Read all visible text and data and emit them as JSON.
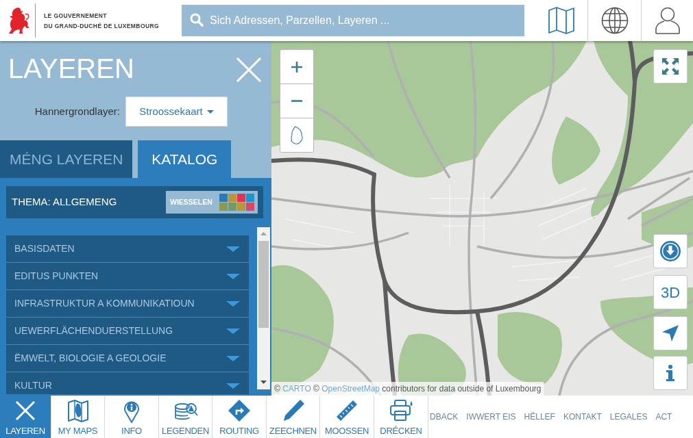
{
  "header": {
    "logo_lines": [
      "LE GOUVERNEMENT",
      "DU GRAND-DUCHÉ DE LUXEMBOURG"
    ],
    "search": {
      "placeholder": "Sich Adressen, Parzellen, Layeren ..."
    }
  },
  "panel": {
    "title": "LAYEREN",
    "background_label": "Hannergrondlayer:",
    "background_value": "Stroossekaart",
    "tabs": [
      {
        "label": "MÉNG LAYEREN",
        "selected": false
      },
      {
        "label": "KATALOG",
        "selected": true
      }
    ],
    "theme": {
      "label": "THEMA: ALLGEMENG",
      "button": "WIESSELEN",
      "swatches": [
        {
          "color": "#2a7ab8"
        },
        {
          "color": "#b8963a"
        },
        {
          "color": "#e0335a"
        },
        {
          "color": "#1e95c8"
        },
        {
          "color": "#8a9a4e"
        },
        {
          "color": "#739a6a"
        },
        {
          "color": "#b8963a"
        },
        {
          "color": "#d6476a"
        }
      ]
    },
    "catalog": [
      {
        "label": "BASISDATEN"
      },
      {
        "label": "EDITUS PUNKTEN"
      },
      {
        "label": "INFRASTRUKTUR A KOMMUNIKATIOUN"
      },
      {
        "label": "UEWERFLÄCHENDUERSTELLUNG"
      },
      {
        "label": "ËMWELT, BIOLOGIE A GEOLOGIE"
      },
      {
        "label": "KULTUR"
      }
    ]
  },
  "map": {
    "button_3d": "3D",
    "attribution": [
      {
        "kind": "text",
        "text": "©"
      },
      {
        "kind": "link",
        "text": "CARTO"
      },
      {
        "kind": "text",
        "text": "©"
      },
      {
        "kind": "link",
        "text": "OpenStreetMap"
      },
      {
        "kind": "text",
        "text": "contributors for data outside of Luxembourg"
      }
    ]
  },
  "bottom_bar": {
    "items": [
      {
        "kind": "close",
        "label": "LAYEREN",
        "selected": true
      },
      {
        "kind": "map",
        "label": "MY MAPS",
        "selected": false
      },
      {
        "kind": "info",
        "label": "INFO",
        "selected": false
      },
      {
        "kind": "legend",
        "label": "LEGENDEN",
        "selected": false
      },
      {
        "kind": "routing",
        "label": "ROUTING",
        "selected": false
      },
      {
        "kind": "pencil",
        "label": "ZEECHNEN",
        "selected": false
      },
      {
        "kind": "ruler",
        "label": "MOOSSEN",
        "selected": false
      },
      {
        "kind": "printer",
        "label": "DRÉCKEN",
        "selected": false
      }
    ]
  },
  "footer_links": [
    "DBACK",
    "IWWERT EIS",
    "HËLLEF",
    "KONTAKT",
    "LEGALES",
    "ACT"
  ]
}
